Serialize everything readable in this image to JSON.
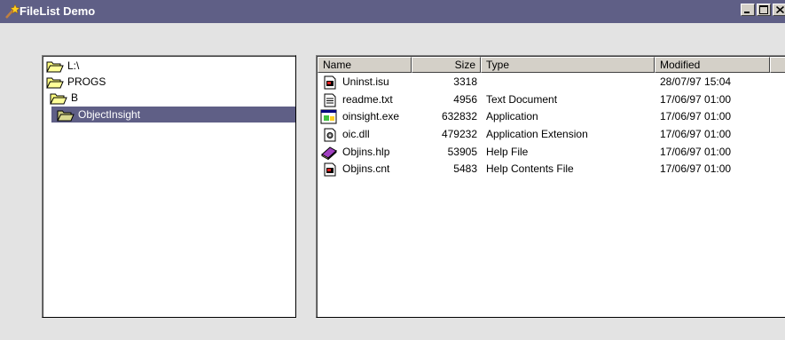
{
  "window": {
    "title": "FileList Demo"
  },
  "tree": {
    "items": [
      {
        "label": "L:\\",
        "selected": false
      },
      {
        "label": "PROGS",
        "selected": false
      },
      {
        "label": "B",
        "selected": false
      },
      {
        "label": "ObjectInsight",
        "selected": true
      }
    ]
  },
  "list": {
    "columns": [
      "Name",
      "Size",
      "Type",
      "Modified"
    ],
    "rows": [
      {
        "name": "Uninst.isu",
        "size": "3318",
        "type": "",
        "modified": "28/07/97  15:04",
        "icon": "installer-file-icon"
      },
      {
        "name": "readme.txt",
        "size": "4956",
        "type": "Text Document",
        "modified": "17/06/97  01:00",
        "icon": "text-file-icon"
      },
      {
        "name": "oinsight.exe",
        "size": "632832",
        "type": "Application",
        "modified": "17/06/97  01:00",
        "icon": "application-icon"
      },
      {
        "name": "oic.dll",
        "size": "479232",
        "type": "Application Extension",
        "modified": "17/06/97  01:00",
        "icon": "dll-file-icon"
      },
      {
        "name": "Objins.hlp",
        "size": "53905",
        "type": "Help File",
        "modified": "17/06/97  01:00",
        "icon": "help-book-icon"
      },
      {
        "name": "Objins.cnt",
        "size": "5483",
        "type": "Help Contents File",
        "modified": "17/06/97  01:00",
        "icon": "installer-file-icon"
      }
    ]
  },
  "colors": {
    "titlebar": "#5f5f86",
    "selection": "#5f5f86",
    "background": "#e3e3e3"
  }
}
